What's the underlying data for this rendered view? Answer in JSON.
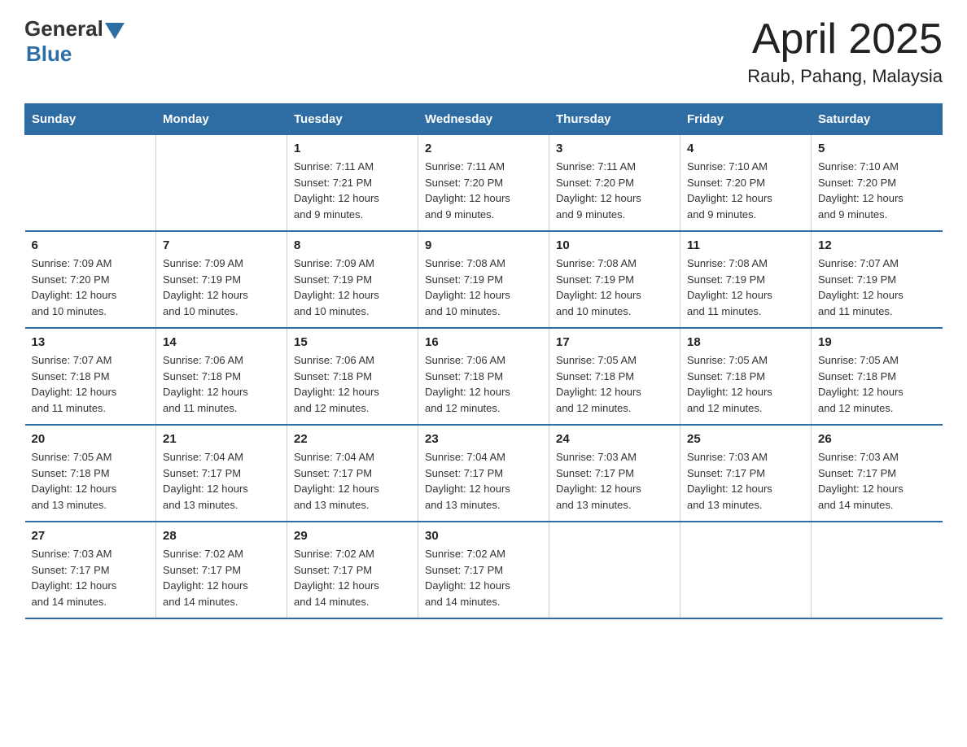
{
  "logo": {
    "general": "General",
    "blue": "Blue"
  },
  "title": {
    "month_year": "April 2025",
    "location": "Raub, Pahang, Malaysia"
  },
  "headers": [
    "Sunday",
    "Monday",
    "Tuesday",
    "Wednesday",
    "Thursday",
    "Friday",
    "Saturday"
  ],
  "weeks": [
    [
      {
        "day": "",
        "info": ""
      },
      {
        "day": "",
        "info": ""
      },
      {
        "day": "1",
        "info": "Sunrise: 7:11 AM\nSunset: 7:21 PM\nDaylight: 12 hours\nand 9 minutes."
      },
      {
        "day": "2",
        "info": "Sunrise: 7:11 AM\nSunset: 7:20 PM\nDaylight: 12 hours\nand 9 minutes."
      },
      {
        "day": "3",
        "info": "Sunrise: 7:11 AM\nSunset: 7:20 PM\nDaylight: 12 hours\nand 9 minutes."
      },
      {
        "day": "4",
        "info": "Sunrise: 7:10 AM\nSunset: 7:20 PM\nDaylight: 12 hours\nand 9 minutes."
      },
      {
        "day": "5",
        "info": "Sunrise: 7:10 AM\nSunset: 7:20 PM\nDaylight: 12 hours\nand 9 minutes."
      }
    ],
    [
      {
        "day": "6",
        "info": "Sunrise: 7:09 AM\nSunset: 7:20 PM\nDaylight: 12 hours\nand 10 minutes."
      },
      {
        "day": "7",
        "info": "Sunrise: 7:09 AM\nSunset: 7:19 PM\nDaylight: 12 hours\nand 10 minutes."
      },
      {
        "day": "8",
        "info": "Sunrise: 7:09 AM\nSunset: 7:19 PM\nDaylight: 12 hours\nand 10 minutes."
      },
      {
        "day": "9",
        "info": "Sunrise: 7:08 AM\nSunset: 7:19 PM\nDaylight: 12 hours\nand 10 minutes."
      },
      {
        "day": "10",
        "info": "Sunrise: 7:08 AM\nSunset: 7:19 PM\nDaylight: 12 hours\nand 10 minutes."
      },
      {
        "day": "11",
        "info": "Sunrise: 7:08 AM\nSunset: 7:19 PM\nDaylight: 12 hours\nand 11 minutes."
      },
      {
        "day": "12",
        "info": "Sunrise: 7:07 AM\nSunset: 7:19 PM\nDaylight: 12 hours\nand 11 minutes."
      }
    ],
    [
      {
        "day": "13",
        "info": "Sunrise: 7:07 AM\nSunset: 7:18 PM\nDaylight: 12 hours\nand 11 minutes."
      },
      {
        "day": "14",
        "info": "Sunrise: 7:06 AM\nSunset: 7:18 PM\nDaylight: 12 hours\nand 11 minutes."
      },
      {
        "day": "15",
        "info": "Sunrise: 7:06 AM\nSunset: 7:18 PM\nDaylight: 12 hours\nand 12 minutes."
      },
      {
        "day": "16",
        "info": "Sunrise: 7:06 AM\nSunset: 7:18 PM\nDaylight: 12 hours\nand 12 minutes."
      },
      {
        "day": "17",
        "info": "Sunrise: 7:05 AM\nSunset: 7:18 PM\nDaylight: 12 hours\nand 12 minutes."
      },
      {
        "day": "18",
        "info": "Sunrise: 7:05 AM\nSunset: 7:18 PM\nDaylight: 12 hours\nand 12 minutes."
      },
      {
        "day": "19",
        "info": "Sunrise: 7:05 AM\nSunset: 7:18 PM\nDaylight: 12 hours\nand 12 minutes."
      }
    ],
    [
      {
        "day": "20",
        "info": "Sunrise: 7:05 AM\nSunset: 7:18 PM\nDaylight: 12 hours\nand 13 minutes."
      },
      {
        "day": "21",
        "info": "Sunrise: 7:04 AM\nSunset: 7:17 PM\nDaylight: 12 hours\nand 13 minutes."
      },
      {
        "day": "22",
        "info": "Sunrise: 7:04 AM\nSunset: 7:17 PM\nDaylight: 12 hours\nand 13 minutes."
      },
      {
        "day": "23",
        "info": "Sunrise: 7:04 AM\nSunset: 7:17 PM\nDaylight: 12 hours\nand 13 minutes."
      },
      {
        "day": "24",
        "info": "Sunrise: 7:03 AM\nSunset: 7:17 PM\nDaylight: 12 hours\nand 13 minutes."
      },
      {
        "day": "25",
        "info": "Sunrise: 7:03 AM\nSunset: 7:17 PM\nDaylight: 12 hours\nand 13 minutes."
      },
      {
        "day": "26",
        "info": "Sunrise: 7:03 AM\nSunset: 7:17 PM\nDaylight: 12 hours\nand 14 minutes."
      }
    ],
    [
      {
        "day": "27",
        "info": "Sunrise: 7:03 AM\nSunset: 7:17 PM\nDaylight: 12 hours\nand 14 minutes."
      },
      {
        "day": "28",
        "info": "Sunrise: 7:02 AM\nSunset: 7:17 PM\nDaylight: 12 hours\nand 14 minutes."
      },
      {
        "day": "29",
        "info": "Sunrise: 7:02 AM\nSunset: 7:17 PM\nDaylight: 12 hours\nand 14 minutes."
      },
      {
        "day": "30",
        "info": "Sunrise: 7:02 AM\nSunset: 7:17 PM\nDaylight: 12 hours\nand 14 minutes."
      },
      {
        "day": "",
        "info": ""
      },
      {
        "day": "",
        "info": ""
      },
      {
        "day": "",
        "info": ""
      }
    ]
  ]
}
